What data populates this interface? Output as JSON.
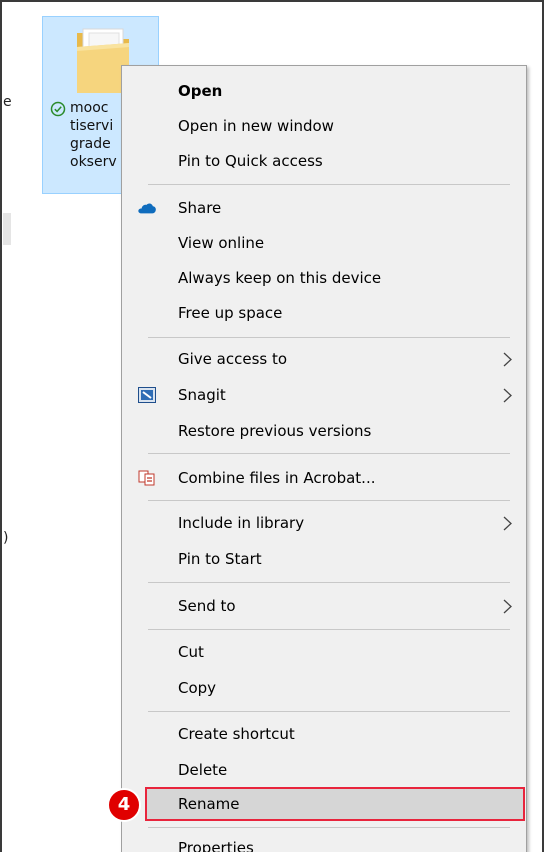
{
  "explorer": {
    "file_name": "mooc\ntiservi\ngrade\nokserv",
    "edge_text_1": "e",
    "edge_text_2": ")"
  },
  "context_menu": {
    "items": [
      {
        "label": "Open"
      },
      {
        "label": "Open in new window"
      },
      {
        "label": "Pin to Quick access"
      },
      {
        "label": "Share",
        "icon": "onedrive-cloud-icon"
      },
      {
        "label": "View online"
      },
      {
        "label": "Always keep on this device"
      },
      {
        "label": "Free up space"
      },
      {
        "label": "Give access to"
      },
      {
        "label": "Snagit",
        "icon": "snagit-icon"
      },
      {
        "label": "Restore previous versions"
      },
      {
        "label": "Combine files in Acrobat...",
        "icon": "acrobat-combine-icon"
      },
      {
        "label": "Include in library"
      },
      {
        "label": "Pin to Start"
      },
      {
        "label": "Send to"
      },
      {
        "label": "Cut"
      },
      {
        "label": "Copy"
      },
      {
        "label": "Create shortcut"
      },
      {
        "label": "Delete"
      },
      {
        "label": "Rename"
      },
      {
        "label": "Properties"
      }
    ]
  },
  "annotation": {
    "step_number": "4",
    "highlight_color": "#e8243c",
    "badge_color": "#e00000"
  },
  "colors": {
    "selection_bg": "#cce8ff",
    "selection_border": "#99d1ff",
    "menu_bg": "#f0f0f0",
    "hover_bg": "#d6d6d6",
    "onedrive_blue": "#0f6cbd"
  }
}
